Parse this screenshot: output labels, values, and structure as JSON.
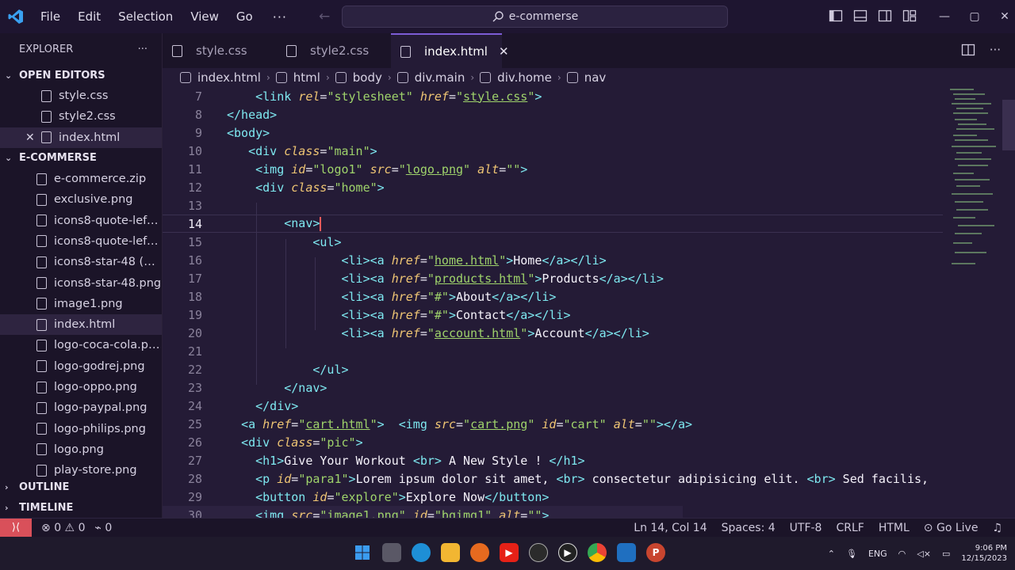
{
  "titlebar": {
    "menu": [
      "File",
      "Edit",
      "Selection",
      "View",
      "Go"
    ],
    "more": "···",
    "search_text": "e-commerse"
  },
  "sidebar": {
    "title": "EXPLORER",
    "more": "···",
    "open_editors_label": "OPEN EDITORS",
    "open_editors": [
      "style.css",
      "style2.css",
      "index.html"
    ],
    "project_label": "E-COMMERSE",
    "files": [
      "e-commerce.zip",
      "exclusive.png",
      "icons8-quote-left...",
      "icons8-quote-left...",
      "icons8-star-48 (1)....",
      "icons8-star-48.png",
      "image1.png",
      "index.html",
      "logo-coca-cola.png",
      "logo-godrej.png",
      "logo-oppo.png",
      "logo-paypal.png",
      "logo-philips.png",
      "logo.png",
      "play-store.png"
    ],
    "outline_label": "OUTLINE",
    "timeline_label": "TIMELINE"
  },
  "tabs": [
    {
      "label": "style.css"
    },
    {
      "label": "style2.css"
    },
    {
      "label": "index.html"
    }
  ],
  "breadcrumb": [
    "index.html",
    "html",
    "body",
    "div.main",
    "div.home",
    "nav"
  ],
  "editor": {
    "line_numbers": [
      "7",
      "8",
      "9",
      "10",
      "11",
      "12",
      "13",
      "14",
      "15",
      "16",
      "17",
      "18",
      "19",
      "20",
      "21",
      "22",
      "23",
      "24",
      "25",
      "26",
      "27",
      "28",
      "29",
      "30"
    ],
    "current_line": "14"
  },
  "status": {
    "problems": "0",
    "warnings": "0",
    "ports": "0",
    "position": "Ln 14, Col 14",
    "spaces": "Spaces: 4",
    "encoding": "UTF-8",
    "eol": "CRLF",
    "language": "HTML",
    "golive": "Go Live"
  },
  "taskbar": {
    "lang": "ENG",
    "time": "9:06 PM",
    "date": "12/15/2023"
  },
  "colors": {
    "accent": "#7c5cd6",
    "remote": "#d9505a",
    "tag": "#7ee8f0",
    "attr": "#f0c674",
    "string": "#9fd36b"
  }
}
